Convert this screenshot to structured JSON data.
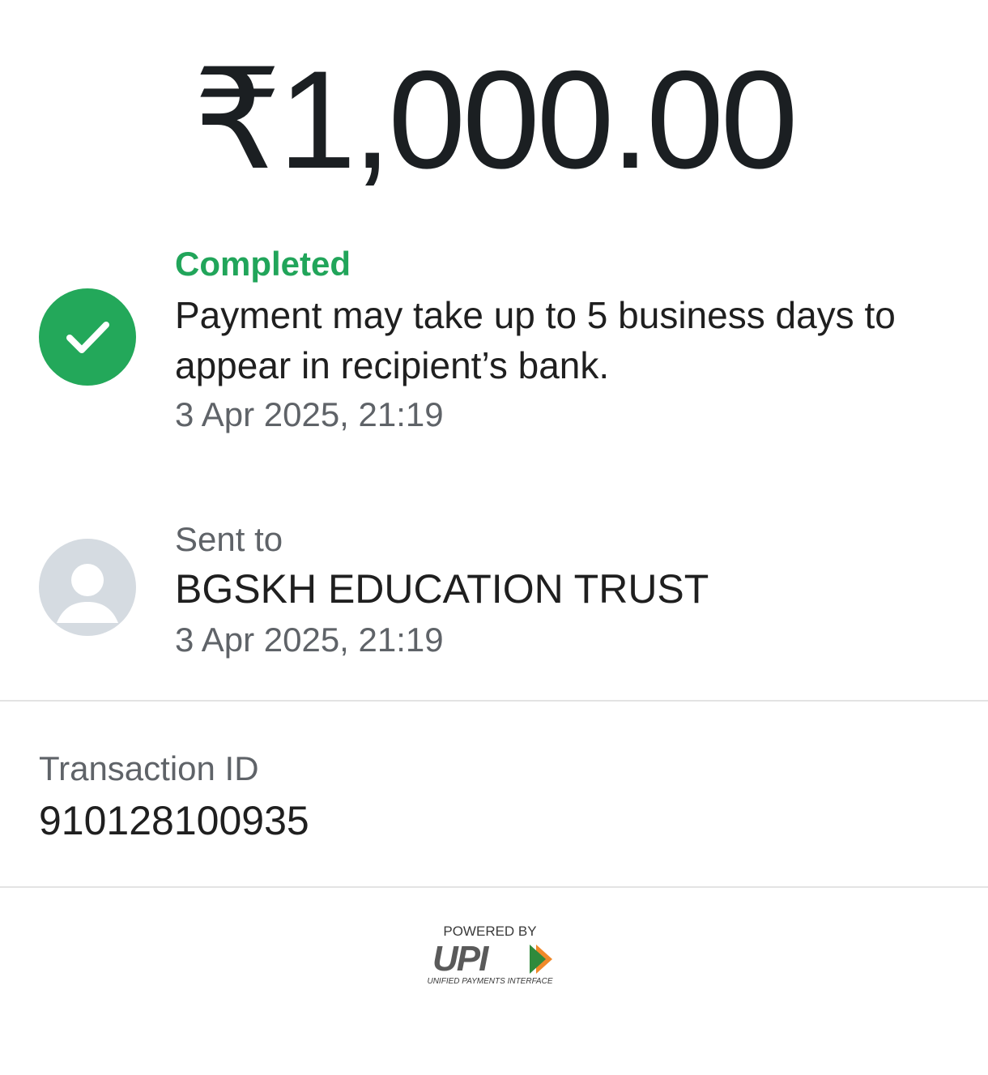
{
  "amount": "₹1,000.00",
  "status": {
    "label": "Completed",
    "message": "Payment may take up to 5 business days to appear in recipient’s bank.",
    "timestamp": "3 Apr 2025, 21:19",
    "icon": "check-circle-icon",
    "color": "#23a85a"
  },
  "recipient": {
    "label": "Sent to",
    "name": "BGSKH EDUCATION TRUST",
    "timestamp": "3 Apr 2025, 21:19",
    "icon": "avatar-placeholder-icon"
  },
  "transaction": {
    "label": "Transaction ID",
    "id": "910128100935"
  },
  "footer": {
    "powered_by": "POWERED BY",
    "logo_text": "UPI",
    "tagline": "UNIFIED PAYMENTS INTERFACE"
  }
}
